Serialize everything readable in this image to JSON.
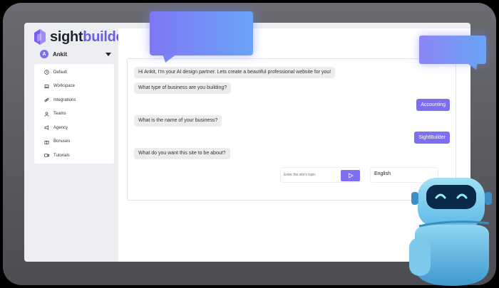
{
  "brand": {
    "name_prefix": "sight",
    "name_suffix": "builder",
    "accent_color": "#6b5de6"
  },
  "user": {
    "initial": "A",
    "name": "Ankit"
  },
  "sidebar": {
    "items": [
      {
        "label": "Default",
        "icon": "clock-icon"
      },
      {
        "label": "Workspace",
        "icon": "laptop-icon"
      },
      {
        "label": "Integrations",
        "icon": "link-icon"
      },
      {
        "label": "Teams",
        "icon": "user-icon"
      },
      {
        "label": "Agency",
        "icon": "megaphone-icon"
      },
      {
        "label": "Bonuses",
        "icon": "gift-icon"
      },
      {
        "label": "Tutorials",
        "icon": "video-icon"
      }
    ]
  },
  "chat": {
    "messages": [
      {
        "from": "bot",
        "text": "Hi Ankit, I'm your AI design partner. Lets create a beautiful professional website for you!"
      },
      {
        "from": "bot",
        "text": "What type of business are you building?"
      },
      {
        "from": "user",
        "text": "Accounting"
      },
      {
        "from": "bot",
        "text": "What is the name of your business?"
      },
      {
        "from": "user",
        "text": "SightBuilder"
      },
      {
        "from": "bot",
        "text": "What do you want this site to be about?"
      }
    ],
    "input_placeholder": "Enter the site's topic",
    "language": "English"
  }
}
